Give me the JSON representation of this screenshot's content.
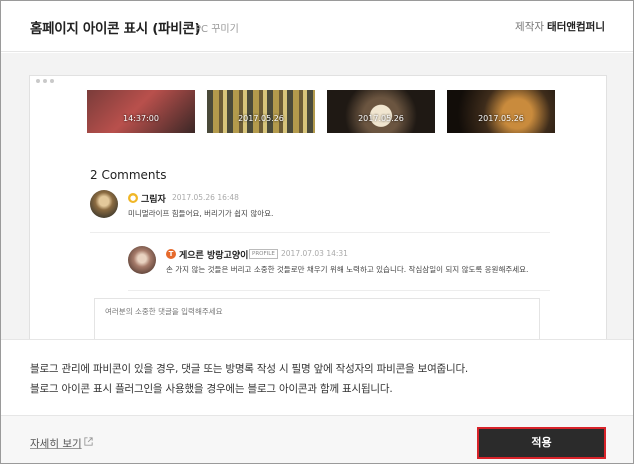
{
  "header": {
    "title": "홈페이지 아이콘 표시 (파비콘)",
    "subtitle": "PC 꾸미기",
    "maker_label": "제작자",
    "maker_name": "태터앤컴퍼니"
  },
  "preview": {
    "thumbnails": [
      {
        "date": "14:37:00"
      },
      {
        "date": "2017.05.26"
      },
      {
        "date": "2017.05.26"
      },
      {
        "date": "2017.05.26"
      }
    ],
    "comments_title": "2 Comments",
    "comments": [
      {
        "author": "그림자",
        "date": "2017.05.26 16:48",
        "text": "미니멀라이프 힘들어요, 버리기가 쉽지 않아요.",
        "badge_color": "#f0b626"
      },
      {
        "author": "게으른 방랑고양이",
        "profile_tag": "PROFILE",
        "date": "2017.07.03 14:31",
        "text": "손 가지 않는 것들은 버리고 소중한 것들로만 채우기 위해 노력하고 있습니다. 작심삼일이 되지 않도록 응원해주세요.",
        "badge_color": "#e66a2c"
      }
    ],
    "comment_input_placeholder": "여러분의 소중한 댓글을 입력해주세요"
  },
  "description": {
    "line1": "블로그 관리에 파비콘이 있을 경우, 댓글 또는 방명록 작성 시 필명 앞에 작성자의 파비콘을 보여줍니다.",
    "line2": "블로그 아이콘 표시 플러그인을 사용했을 경우에는 블로그 아이콘과 함께 표시됩니다."
  },
  "footer": {
    "more_link": "자세히 보기",
    "apply_button": "적용",
    "highlight_color": "#d8232a"
  },
  "icons": {
    "external_link": "external-link-icon"
  }
}
